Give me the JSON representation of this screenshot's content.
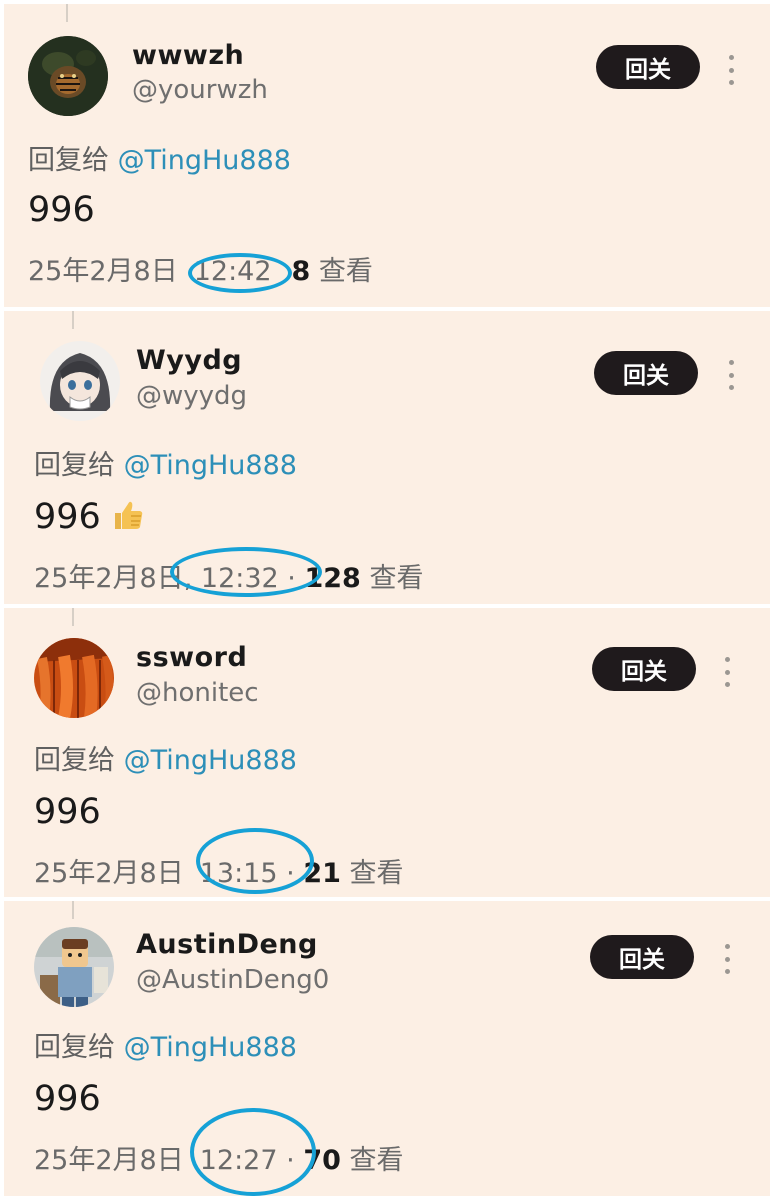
{
  "accent_color": "#16a1d6",
  "follow_button_color": "#1f1a1c",
  "link_color": "#2d8fb8",
  "tweets": [
    {
      "display_name": "wwwzh",
      "handle": "@yourwzh",
      "follow_label": "回关",
      "reply_prefix": "回复给",
      "reply_target": "@TingHu888",
      "text": "996",
      "date": "25年2月8日",
      "time": "12:42",
      "views_count": "8",
      "views_label": "查看",
      "avatar_icon": "tiger-avatar-icon"
    },
    {
      "display_name": "Wyydg",
      "handle": "@wyydg",
      "follow_label": "回关",
      "reply_prefix": "回复给",
      "reply_target": "@TingHu888",
      "text": "996",
      "emoji": "thumbs-up-icon",
      "date": "25年2月8日,",
      "time": "12:32",
      "separator": "·",
      "views_count": "128",
      "views_label": "查看",
      "avatar_icon": "anime-girl-avatar-icon"
    },
    {
      "display_name": "ssword",
      "handle": "@honitec",
      "follow_label": "回关",
      "reply_prefix": "回复给",
      "reply_target": "@TingHu888",
      "text": "996",
      "date": "25年2月8日",
      "time": "13:15",
      "separator": "·",
      "views_count": "21",
      "views_label": "查看",
      "avatar_icon": "orange-texture-avatar-icon"
    },
    {
      "display_name": "AustinDeng",
      "handle": "@AustinDeng0",
      "follow_label": "回关",
      "reply_prefix": "回复给",
      "reply_target": "@TingHu888",
      "text": "996",
      "date": "25年2月8日",
      "time": "12:27",
      "separator": "·",
      "views_count": "70",
      "views_label": "查看",
      "avatar_icon": "lego-figure-avatar-icon"
    }
  ]
}
